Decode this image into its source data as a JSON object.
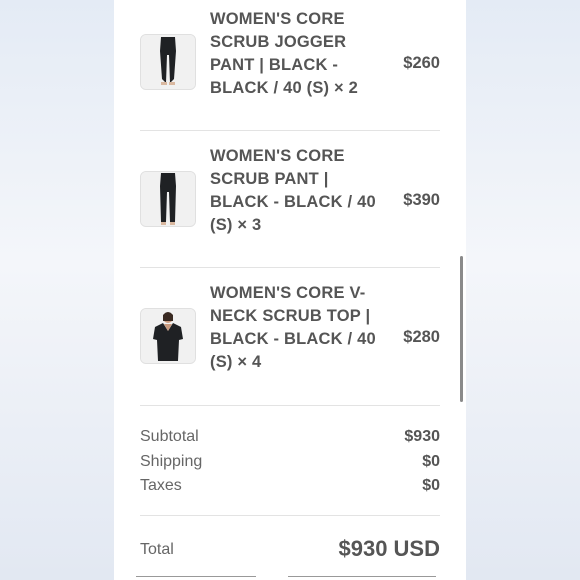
{
  "cart": {
    "items": [
      {
        "name": "WOMEN'S CORE SCRUB JOGGER PANT | BLACK - BLACK / 40 (S) × 2",
        "price": "$260",
        "thumb_icon": "jogger-pant-photo"
      },
      {
        "name": "WOMEN'S CORE SCRUB PANT | BLACK - BLACK / 40 (S) × 3",
        "price": "$390",
        "thumb_icon": "scrub-pant-photo"
      },
      {
        "name": "WOMEN'S CORE V-NECK SCRUB TOP | BLACK - BLACK / 40 (S) × 4",
        "price": "$280",
        "thumb_icon": "scrub-top-photo"
      }
    ]
  },
  "summary": {
    "subtotal_label": "Subtotal",
    "subtotal_value": "$930",
    "shipping_label": "Shipping",
    "shipping_value": "$0",
    "taxes_label": "Taxes",
    "taxes_value": "$0",
    "total_label": "Total",
    "total_value": "$930 USD"
  },
  "colors": {
    "text": "#555555",
    "panel": "#ffffff",
    "divider": "#e3e3e3"
  }
}
